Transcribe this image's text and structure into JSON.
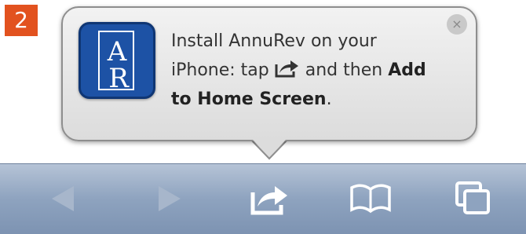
{
  "step_badge": "2",
  "popover": {
    "app_icon": {
      "letters": "AR",
      "icon": "annurev-app-icon"
    },
    "message_line_1": "Install AnnuRev on your",
    "message_line_2_prefix": "iPhone: tap",
    "message_line_2_suffix": "and then",
    "add_bold_1": "Add",
    "add_bold_2": "to Home Screen",
    "message_end": ".",
    "close_label": "×",
    "share_icon": "share-icon"
  },
  "toolbar": {
    "items": [
      {
        "name": "back",
        "icon": "back-arrow-icon",
        "enabled": false
      },
      {
        "name": "forward",
        "icon": "forward-arrow-icon",
        "enabled": false
      },
      {
        "name": "share",
        "icon": "share-icon",
        "enabled": true
      },
      {
        "name": "bookmarks",
        "icon": "book-icon",
        "enabled": true
      },
      {
        "name": "tabs",
        "icon": "tabs-icon",
        "enabled": true
      }
    ]
  },
  "colors": {
    "badge": "#e2521f",
    "app_icon_blue": "#1d52a5",
    "toolbar_top": "#b5c3d6",
    "toolbar_bottom": "#7d93b2"
  }
}
